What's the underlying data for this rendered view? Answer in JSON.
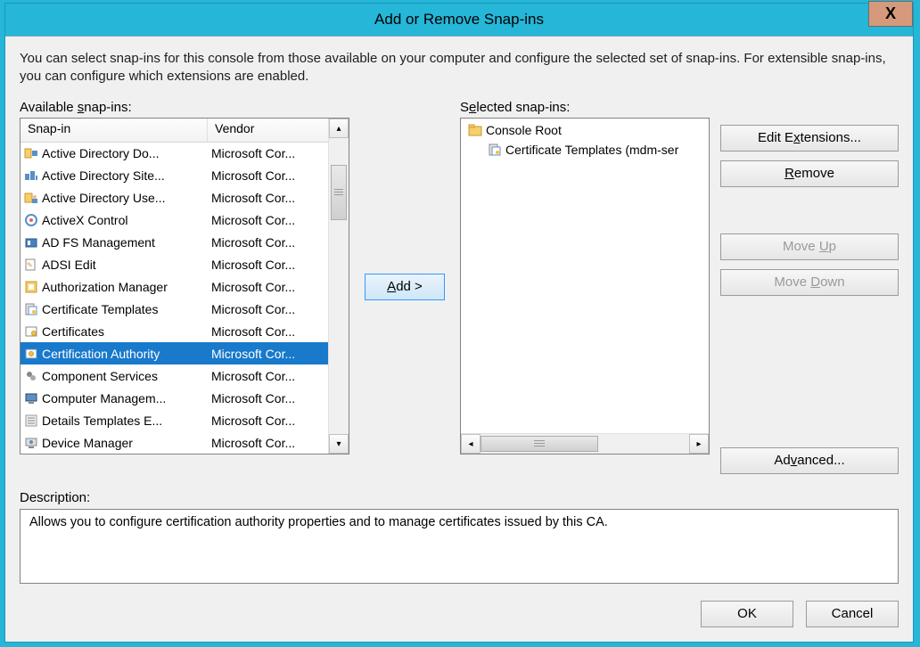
{
  "window": {
    "title": "Add or Remove Snap-ins",
    "close_symbol": "X"
  },
  "intro_text": "You can select snap-ins for this console from those available on your computer and configure the selected set of snap-ins. For extensible snap-ins, you can configure which extensions are enabled.",
  "available": {
    "label": "Available snap-ins:",
    "columns": {
      "snapin": "Snap-in",
      "vendor": "Vendor"
    },
    "rows": [
      {
        "name": "Active Directory Do...",
        "vendor": "Microsoft Cor...",
        "icon": "ad-domain-icon"
      },
      {
        "name": "Active Directory Site...",
        "vendor": "Microsoft Cor...",
        "icon": "ad-sites-icon"
      },
      {
        "name": "Active Directory Use...",
        "vendor": "Microsoft Cor...",
        "icon": "ad-users-icon"
      },
      {
        "name": "ActiveX Control",
        "vendor": "Microsoft Cor...",
        "icon": "activex-icon"
      },
      {
        "name": "AD FS Management",
        "vendor": "Microsoft Cor...",
        "icon": "adfs-icon"
      },
      {
        "name": "ADSI Edit",
        "vendor": "Microsoft Cor...",
        "icon": "adsi-icon"
      },
      {
        "name": "Authorization Manager",
        "vendor": "Microsoft Cor...",
        "icon": "authz-icon"
      },
      {
        "name": "Certificate Templates",
        "vendor": "Microsoft Cor...",
        "icon": "cert-templates-icon"
      },
      {
        "name": "Certificates",
        "vendor": "Microsoft Cor...",
        "icon": "certificates-icon"
      },
      {
        "name": "Certification Authority",
        "vendor": "Microsoft Cor...",
        "icon": "cert-authority-icon",
        "selected": true
      },
      {
        "name": "Component Services",
        "vendor": "Microsoft Cor...",
        "icon": "component-icon"
      },
      {
        "name": "Computer Managem...",
        "vendor": "Microsoft Cor...",
        "icon": "computer-mgmt-icon"
      },
      {
        "name": "Details Templates E...",
        "vendor": "Microsoft Cor...",
        "icon": "details-templates-icon"
      },
      {
        "name": "Device Manager",
        "vendor": "Microsoft Cor...",
        "icon": "device-manager-icon"
      }
    ]
  },
  "selected": {
    "label": "Selected snap-ins:",
    "tree": [
      {
        "name": "Console Root",
        "icon": "folder-icon",
        "indent": false
      },
      {
        "name": "Certificate Templates (mdm-ser",
        "icon": "cert-templates-icon",
        "indent": true
      }
    ]
  },
  "buttons": {
    "add": "Add >",
    "edit_extensions": "Edit Extensions...",
    "remove": "Remove",
    "move_up": "Move Up",
    "move_down": "Move Down",
    "advanced": "Advanced...",
    "ok": "OK",
    "cancel": "Cancel"
  },
  "description": {
    "label": "Description:",
    "text": "Allows you to configure certification authority  properties and to manage certificates issued by this CA."
  },
  "scroll": {
    "up": "▴",
    "down": "▾",
    "left": "◂",
    "right": "▸",
    "grip": "≡"
  }
}
